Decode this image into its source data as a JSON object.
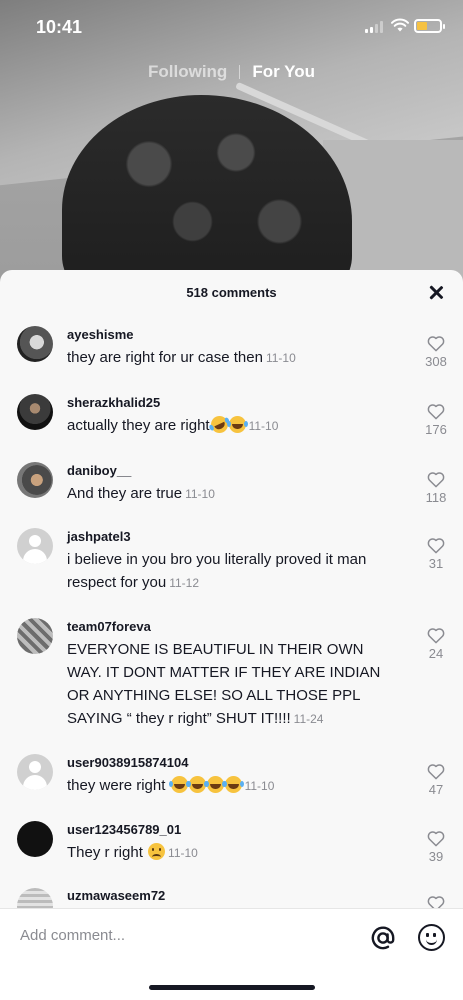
{
  "status_bar": {
    "time": "10:41"
  },
  "feed_tabs": {
    "following": "Following",
    "for_you": "For You"
  },
  "comments_sheet": {
    "title": "518 comments",
    "comments": [
      {
        "username": "ayeshisme",
        "text": "they are right for ur case then",
        "date": "11-10",
        "likes": "308",
        "avatar": "photo"
      },
      {
        "username": "sherazkhalid25",
        "text": "actually they are right",
        "emojis": [
          "rofl-emoji",
          "laughing-emoji"
        ],
        "date": "11-10",
        "likes": "176",
        "avatar": "photo"
      },
      {
        "username": "daniboy__",
        "text": "And they are true",
        "date": "11-10",
        "likes": "118",
        "avatar": "photo"
      },
      {
        "username": "jashpatel3",
        "text": "i believe in you bro you literally proved it man respect for you",
        "date": "11-12",
        "likes": "31",
        "avatar": "default"
      },
      {
        "username": "team07foreva",
        "text": "EVERYONE IS BEAUTIFUL IN THEIR OWN WAY. IT DONT MATTER IF THEY ARE INDIAN OR ANYTHING ELSE! SO ALL THOSE PPL SAYING “ they r right” SHUT IT!!!!",
        "date": "11-24",
        "likes": "24",
        "avatar": "photo"
      },
      {
        "username": "user9038915874104",
        "text": "they were right",
        "emojis": [
          "laughing-emoji",
          "laughing-emoji",
          "laughing-emoji",
          "laughing-emoji"
        ],
        "date": "11-10",
        "likes": "47",
        "avatar": "default"
      },
      {
        "username": "user123456789_01",
        "text": "They r right",
        "emojis": [
          "sad-emoji"
        ],
        "date": "11-10",
        "likes": "39",
        "avatar": "photo"
      },
      {
        "username": "uzmawaseem72",
        "avatar": "photo"
      }
    ]
  },
  "add_comment": {
    "placeholder": "Add comment..."
  },
  "colors": {
    "text": "#161823",
    "secondary": "#8a8b91",
    "sheet": "#f8f8f8"
  }
}
